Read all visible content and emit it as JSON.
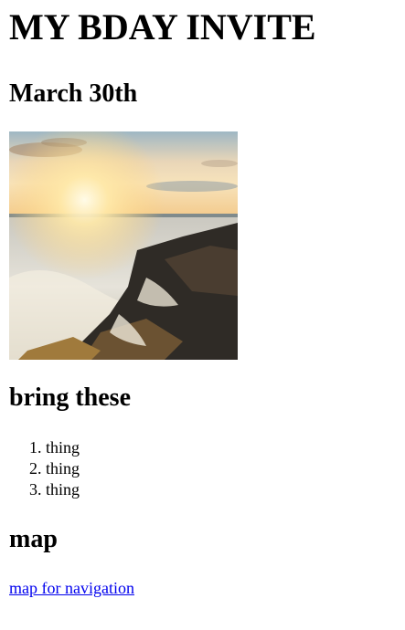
{
  "page": {
    "title": "MY BDAY INVITE",
    "date": "March 30th",
    "bring_heading": "bring these",
    "bring_items": [
      "thing",
      "thing",
      "thing"
    ],
    "map_heading": "map",
    "map_link_text": "map for navigation"
  },
  "colors": {
    "link": "#0000ee",
    "text": "#000000",
    "background": "#ffffff"
  }
}
